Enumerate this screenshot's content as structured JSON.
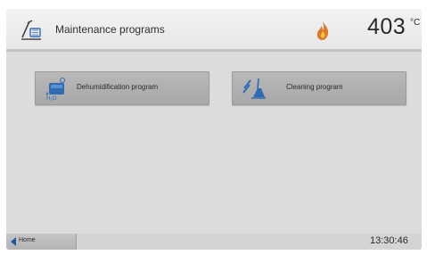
{
  "header": {
    "title": "Maintenance programs",
    "title_icon": "maintenance-wrench-icon",
    "status_icon": "flame-icon",
    "temperature": "403",
    "temperature_unit": "°C"
  },
  "programs": [
    {
      "label": "Dehumidification program",
      "icon": "dehumidification-icon"
    },
    {
      "label": "Cleaning program",
      "icon": "broom-icon"
    }
  ],
  "footer": {
    "home_label": "Home",
    "home_icon": "back-arrow-icon",
    "time": "13:30:46"
  },
  "colors": {
    "background": "#dcdcdc",
    "header": "#ececec",
    "button": "#b0b0b0",
    "accent": "#1f5aa0"
  }
}
